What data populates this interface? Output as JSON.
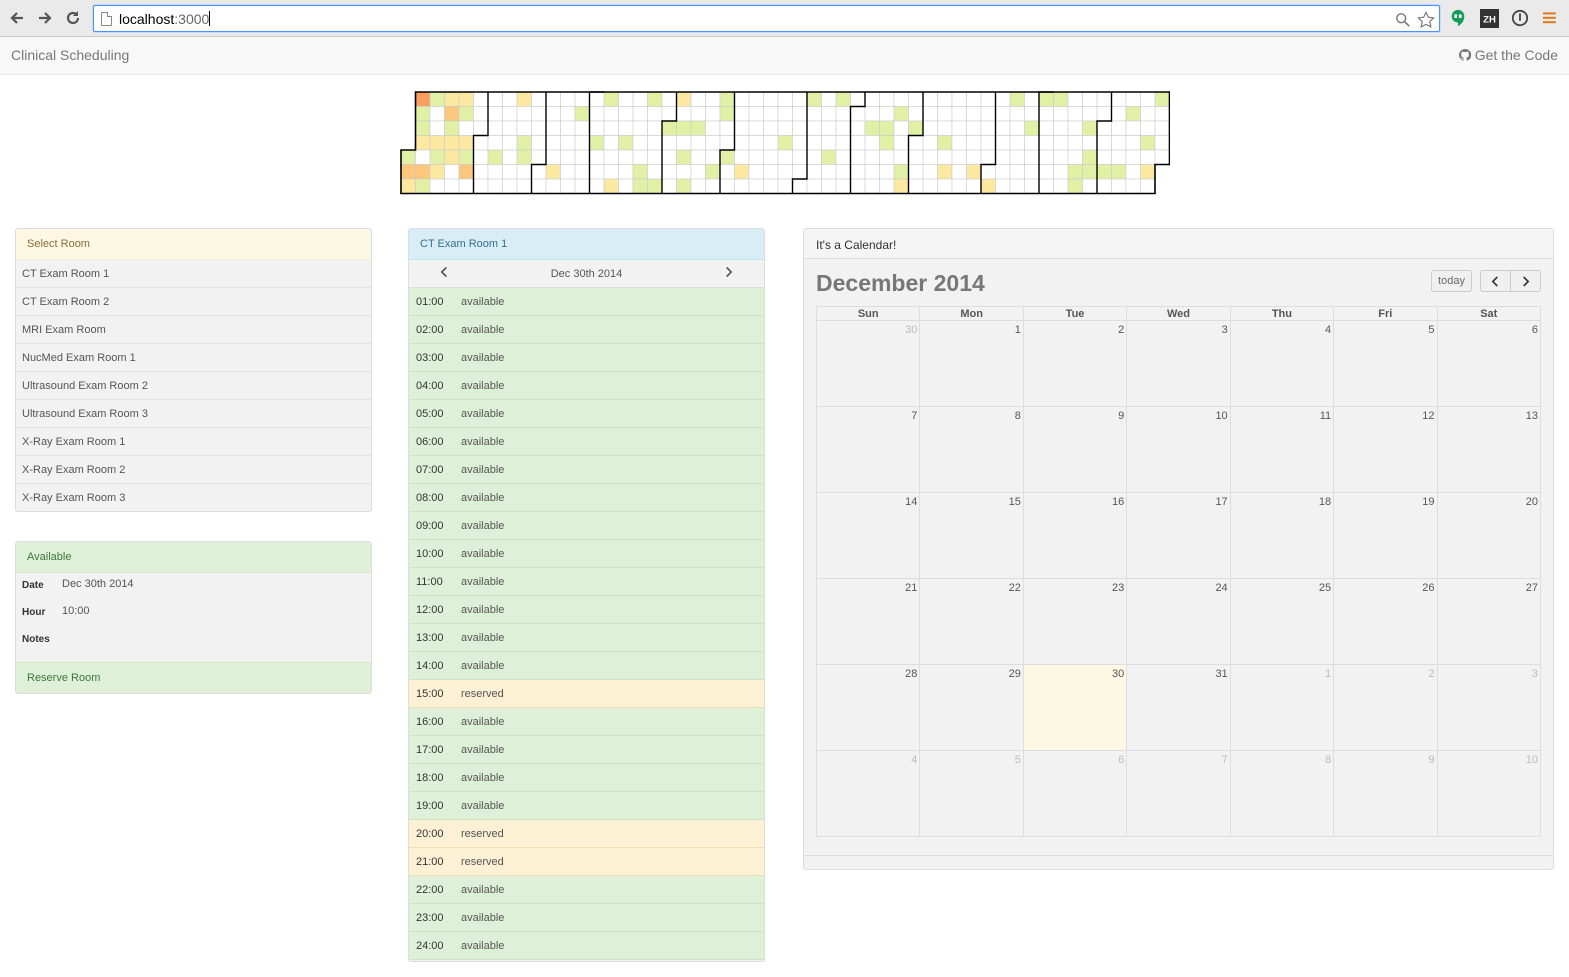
{
  "browser": {
    "url_host": "localhost",
    "url_port": ":3000"
  },
  "navbar": {
    "brand": "Clinical Scheduling",
    "get_code": "Get the Code"
  },
  "heatmap": {
    "colors": {
      "empty": "#ffffff",
      "light": "#e2f0a6",
      "yellow": "#fde8a2",
      "orange": "#fbc77d",
      "dark_orange": "#f79e60"
    }
  },
  "rooms": {
    "heading": "Select Room",
    "items": [
      "CT Exam Room 1",
      "CT Exam Room 2",
      "MRI Exam Room",
      "NucMed Exam Room 1",
      "Ultrasound Exam Room 2",
      "Ultrasound Exam Room 3",
      "X-Ray Exam Room 1",
      "X-Ray Exam Room 2",
      "X-Ray Exam Room 3"
    ]
  },
  "availability": {
    "heading": "Available",
    "date_label": "Date",
    "date_value": "Dec 30th 2014",
    "hour_label": "Hour",
    "hour_value": "10:00",
    "notes_label": "Notes",
    "notes_value": "",
    "reserve_label": "Reserve Room"
  },
  "schedule": {
    "heading": "CT Exam Room 1",
    "date": "Dec 30th 2014",
    "slots": [
      {
        "hour": "01:00",
        "status": "available"
      },
      {
        "hour": "02:00",
        "status": "available"
      },
      {
        "hour": "03:00",
        "status": "available"
      },
      {
        "hour": "04:00",
        "status": "available"
      },
      {
        "hour": "05:00",
        "status": "available"
      },
      {
        "hour": "06:00",
        "status": "available"
      },
      {
        "hour": "07:00",
        "status": "available"
      },
      {
        "hour": "08:00",
        "status": "available"
      },
      {
        "hour": "09:00",
        "status": "available"
      },
      {
        "hour": "10:00",
        "status": "available"
      },
      {
        "hour": "11:00",
        "status": "available"
      },
      {
        "hour": "12:00",
        "status": "available"
      },
      {
        "hour": "13:00",
        "status": "available"
      },
      {
        "hour": "14:00",
        "status": "available"
      },
      {
        "hour": "15:00",
        "status": "reserved"
      },
      {
        "hour": "16:00",
        "status": "available"
      },
      {
        "hour": "17:00",
        "status": "available"
      },
      {
        "hour": "18:00",
        "status": "available"
      },
      {
        "hour": "19:00",
        "status": "available"
      },
      {
        "hour": "20:00",
        "status": "reserved"
      },
      {
        "hour": "21:00",
        "status": "reserved"
      },
      {
        "hour": "22:00",
        "status": "available"
      },
      {
        "hour": "23:00",
        "status": "available"
      },
      {
        "hour": "24:00",
        "status": "available"
      }
    ]
  },
  "calendar": {
    "heading": "It's a Calendar!",
    "month_title": "December 2014",
    "today_label": "today",
    "weekdays": [
      "Sun",
      "Mon",
      "Tue",
      "Wed",
      "Thu",
      "Fri",
      "Sat"
    ],
    "weeks": [
      [
        {
          "d": "30",
          "o": true
        },
        {
          "d": "1"
        },
        {
          "d": "2"
        },
        {
          "d": "3"
        },
        {
          "d": "4"
        },
        {
          "d": "5"
        },
        {
          "d": "6"
        }
      ],
      [
        {
          "d": "7"
        },
        {
          "d": "8"
        },
        {
          "d": "9"
        },
        {
          "d": "10"
        },
        {
          "d": "11"
        },
        {
          "d": "12"
        },
        {
          "d": "13"
        }
      ],
      [
        {
          "d": "14"
        },
        {
          "d": "15"
        },
        {
          "d": "16"
        },
        {
          "d": "17"
        },
        {
          "d": "18"
        },
        {
          "d": "19"
        },
        {
          "d": "20"
        }
      ],
      [
        {
          "d": "21"
        },
        {
          "d": "22"
        },
        {
          "d": "23"
        },
        {
          "d": "24"
        },
        {
          "d": "25"
        },
        {
          "d": "26"
        },
        {
          "d": "27"
        }
      ],
      [
        {
          "d": "28"
        },
        {
          "d": "29"
        },
        {
          "d": "30",
          "t": true
        },
        {
          "d": "31"
        },
        {
          "d": "1",
          "o": true
        },
        {
          "d": "2",
          "o": true
        },
        {
          "d": "3",
          "o": true
        }
      ],
      [
        {
          "d": "4",
          "o": true
        },
        {
          "d": "5",
          "o": true
        },
        {
          "d": "6",
          "o": true
        },
        {
          "d": "7",
          "o": true
        },
        {
          "d": "8",
          "o": true
        },
        {
          "d": "9",
          "o": true
        },
        {
          "d": "10",
          "o": true
        }
      ]
    ]
  }
}
